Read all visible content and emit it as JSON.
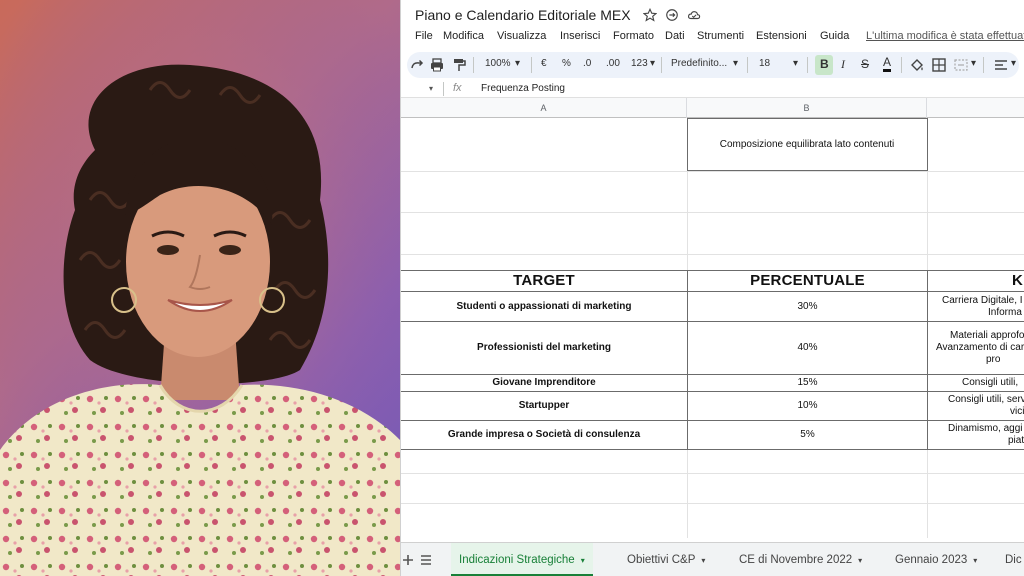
{
  "document": {
    "title": "Piano e Calendario Editoriale MEX",
    "last_edit": "L'ultima modifica è stata effettuata"
  },
  "menu": [
    "File",
    "Modifica",
    "Visualizza",
    "Inserisci",
    "Formato",
    "Dati",
    "Strumenti",
    "Estensioni",
    "Guida"
  ],
  "toolbar": {
    "zoom": "100%",
    "currency": "€",
    "percent": "%",
    "decrease_decimals": ".0",
    "increase_decimals": ".00",
    "number_format": "123",
    "font": "Predefinito...",
    "font_size": "18",
    "bold": "B",
    "italic": "I",
    "strike": "S",
    "text_color": "A"
  },
  "formula_bar": {
    "fx": "fx",
    "content": "Frequenza Posting"
  },
  "columns": [
    "A",
    "B"
  ],
  "summary_cell": "Composizione equilibrata lato contenuti",
  "table": {
    "headers": [
      "TARGET",
      "PERCENTUALE",
      "KE"
    ],
    "rows": [
      {
        "target": "Studenti o appassionati di marketing",
        "pct": "30%",
        "k1": "Carriera Digitale, I",
        "k2": "Informa"
      },
      {
        "target": "Professionisti del marketing",
        "pct": "40%",
        "k1": "Materiali approfo",
        "k2": "Avanzamento di car",
        "k3": "pro"
      },
      {
        "target": "Giovane Imprenditore",
        "pct": "15%",
        "k1": "Consigli utili,"
      },
      {
        "target": "Startupper",
        "pct": "10%",
        "k1": "Consigli utili, serv",
        "k2": "vici"
      },
      {
        "target": "Grande impresa o Società di consulenza",
        "pct": "5%",
        "k1": "Dinamismo, aggi",
        "k2": "piat"
      }
    ]
  },
  "tabs": {
    "items": [
      {
        "label": "Indicazioni Strategiche",
        "active": true
      },
      {
        "label": "Obiettivi C&P",
        "active": false
      },
      {
        "label": "CE di Novembre 2022",
        "active": false
      },
      {
        "label": "Gennaio 2023",
        "active": false
      },
      {
        "label": "Dic",
        "active": false
      }
    ]
  },
  "icons": {
    "star": "star-icon",
    "move": "move-to-drive-icon",
    "cloud": "cloud-status-icon",
    "redo": "redo-icon",
    "print": "print-icon",
    "paint_format": "paint-format-icon",
    "fill": "fill-color-icon",
    "borders": "borders-icon",
    "merge": "merge-cells-icon",
    "align": "align-icon",
    "add_sheet": "add-sheet-icon",
    "all_sheets": "all-sheets-icon"
  },
  "colors": {
    "accent_green": "#188038",
    "active_tab_bg": "#e6f4ea",
    "toolbar_bg": "#edf2fa"
  }
}
